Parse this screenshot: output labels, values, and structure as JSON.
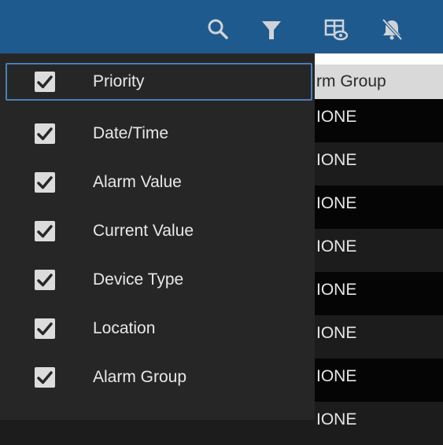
{
  "toolbar": {
    "icons": [
      "search-icon",
      "filter-icon",
      "column-chooser-icon",
      "bell-muted-icon"
    ],
    "background": "#1f5a8e",
    "icon_color": "#cfd3d8"
  },
  "table": {
    "visible_header": "rm Group",
    "rows": [
      "IONE",
      "IONE",
      "IONE",
      "IONE",
      "IONE",
      "IONE",
      "IONE",
      "IONE"
    ]
  },
  "column_menu": {
    "items": [
      {
        "label": "Priority",
        "checked": true
      },
      {
        "label": "Date/Time",
        "checked": true
      },
      {
        "label": "Alarm Value",
        "checked": true
      },
      {
        "label": "Current Value",
        "checked": true
      },
      {
        "label": "Device Type",
        "checked": true
      },
      {
        "label": "Location",
        "checked": true
      },
      {
        "label": "Alarm Group",
        "checked": true
      }
    ],
    "focused_item": "Priority"
  }
}
